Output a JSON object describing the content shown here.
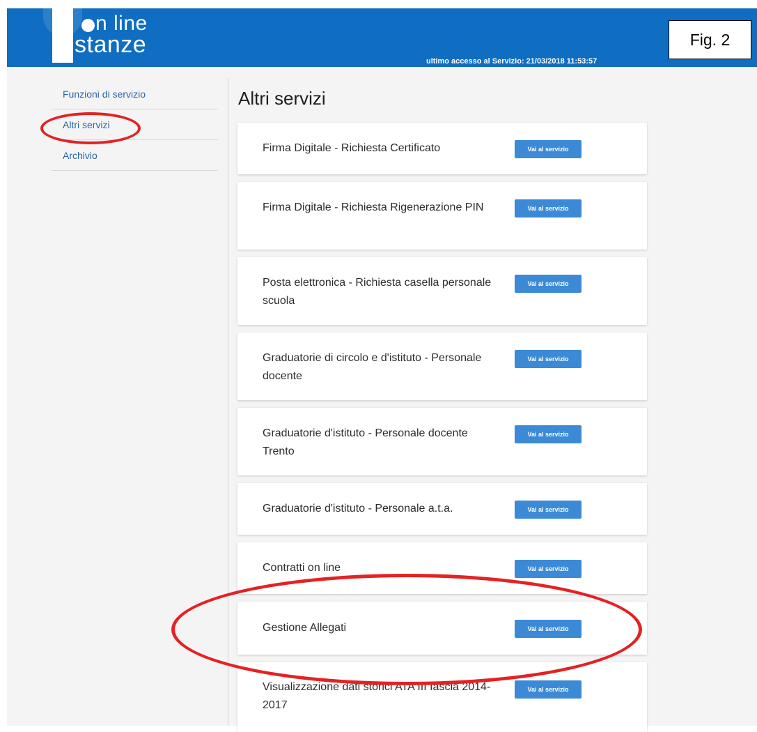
{
  "header": {
    "logo_line1": "n line",
    "logo_line2": "stanze",
    "last_access": "ultimo accesso al Servizio: 21/03/2018 11:53:57",
    "fig_label": "Fig. 2"
  },
  "sidebar": {
    "items": [
      {
        "label": "Funzioni di servizio"
      },
      {
        "label": "Altri servizi"
      },
      {
        "label": "Archivio"
      }
    ]
  },
  "main": {
    "title": "Altri servizi",
    "button_label": "Vai al servizio",
    "services": [
      {
        "name": "Firma Digitale - Richiesta Certificato"
      },
      {
        "name": "Firma Digitale - Richiesta Rigenerazione PIN"
      },
      {
        "name": "Posta elettronica - Richiesta casella personale scuola"
      },
      {
        "name": "Graduatorie di circolo e d'istituto - Personale docente"
      },
      {
        "name": "Graduatorie d'istituto - Personale docente Trento"
      },
      {
        "name": "Graduatorie d'istituto - Personale a.t.a."
      },
      {
        "name": "Contratti on line"
      },
      {
        "name": "Gestione Allegati"
      },
      {
        "name": "Visualizzazione dati storici ATA III fascia 2014-2017"
      }
    ]
  },
  "colors": {
    "header_blue": "#0f6ec2",
    "button_blue": "#3c8ad6",
    "highlight_red": "#e42224",
    "link_blue": "#2a64a8"
  }
}
